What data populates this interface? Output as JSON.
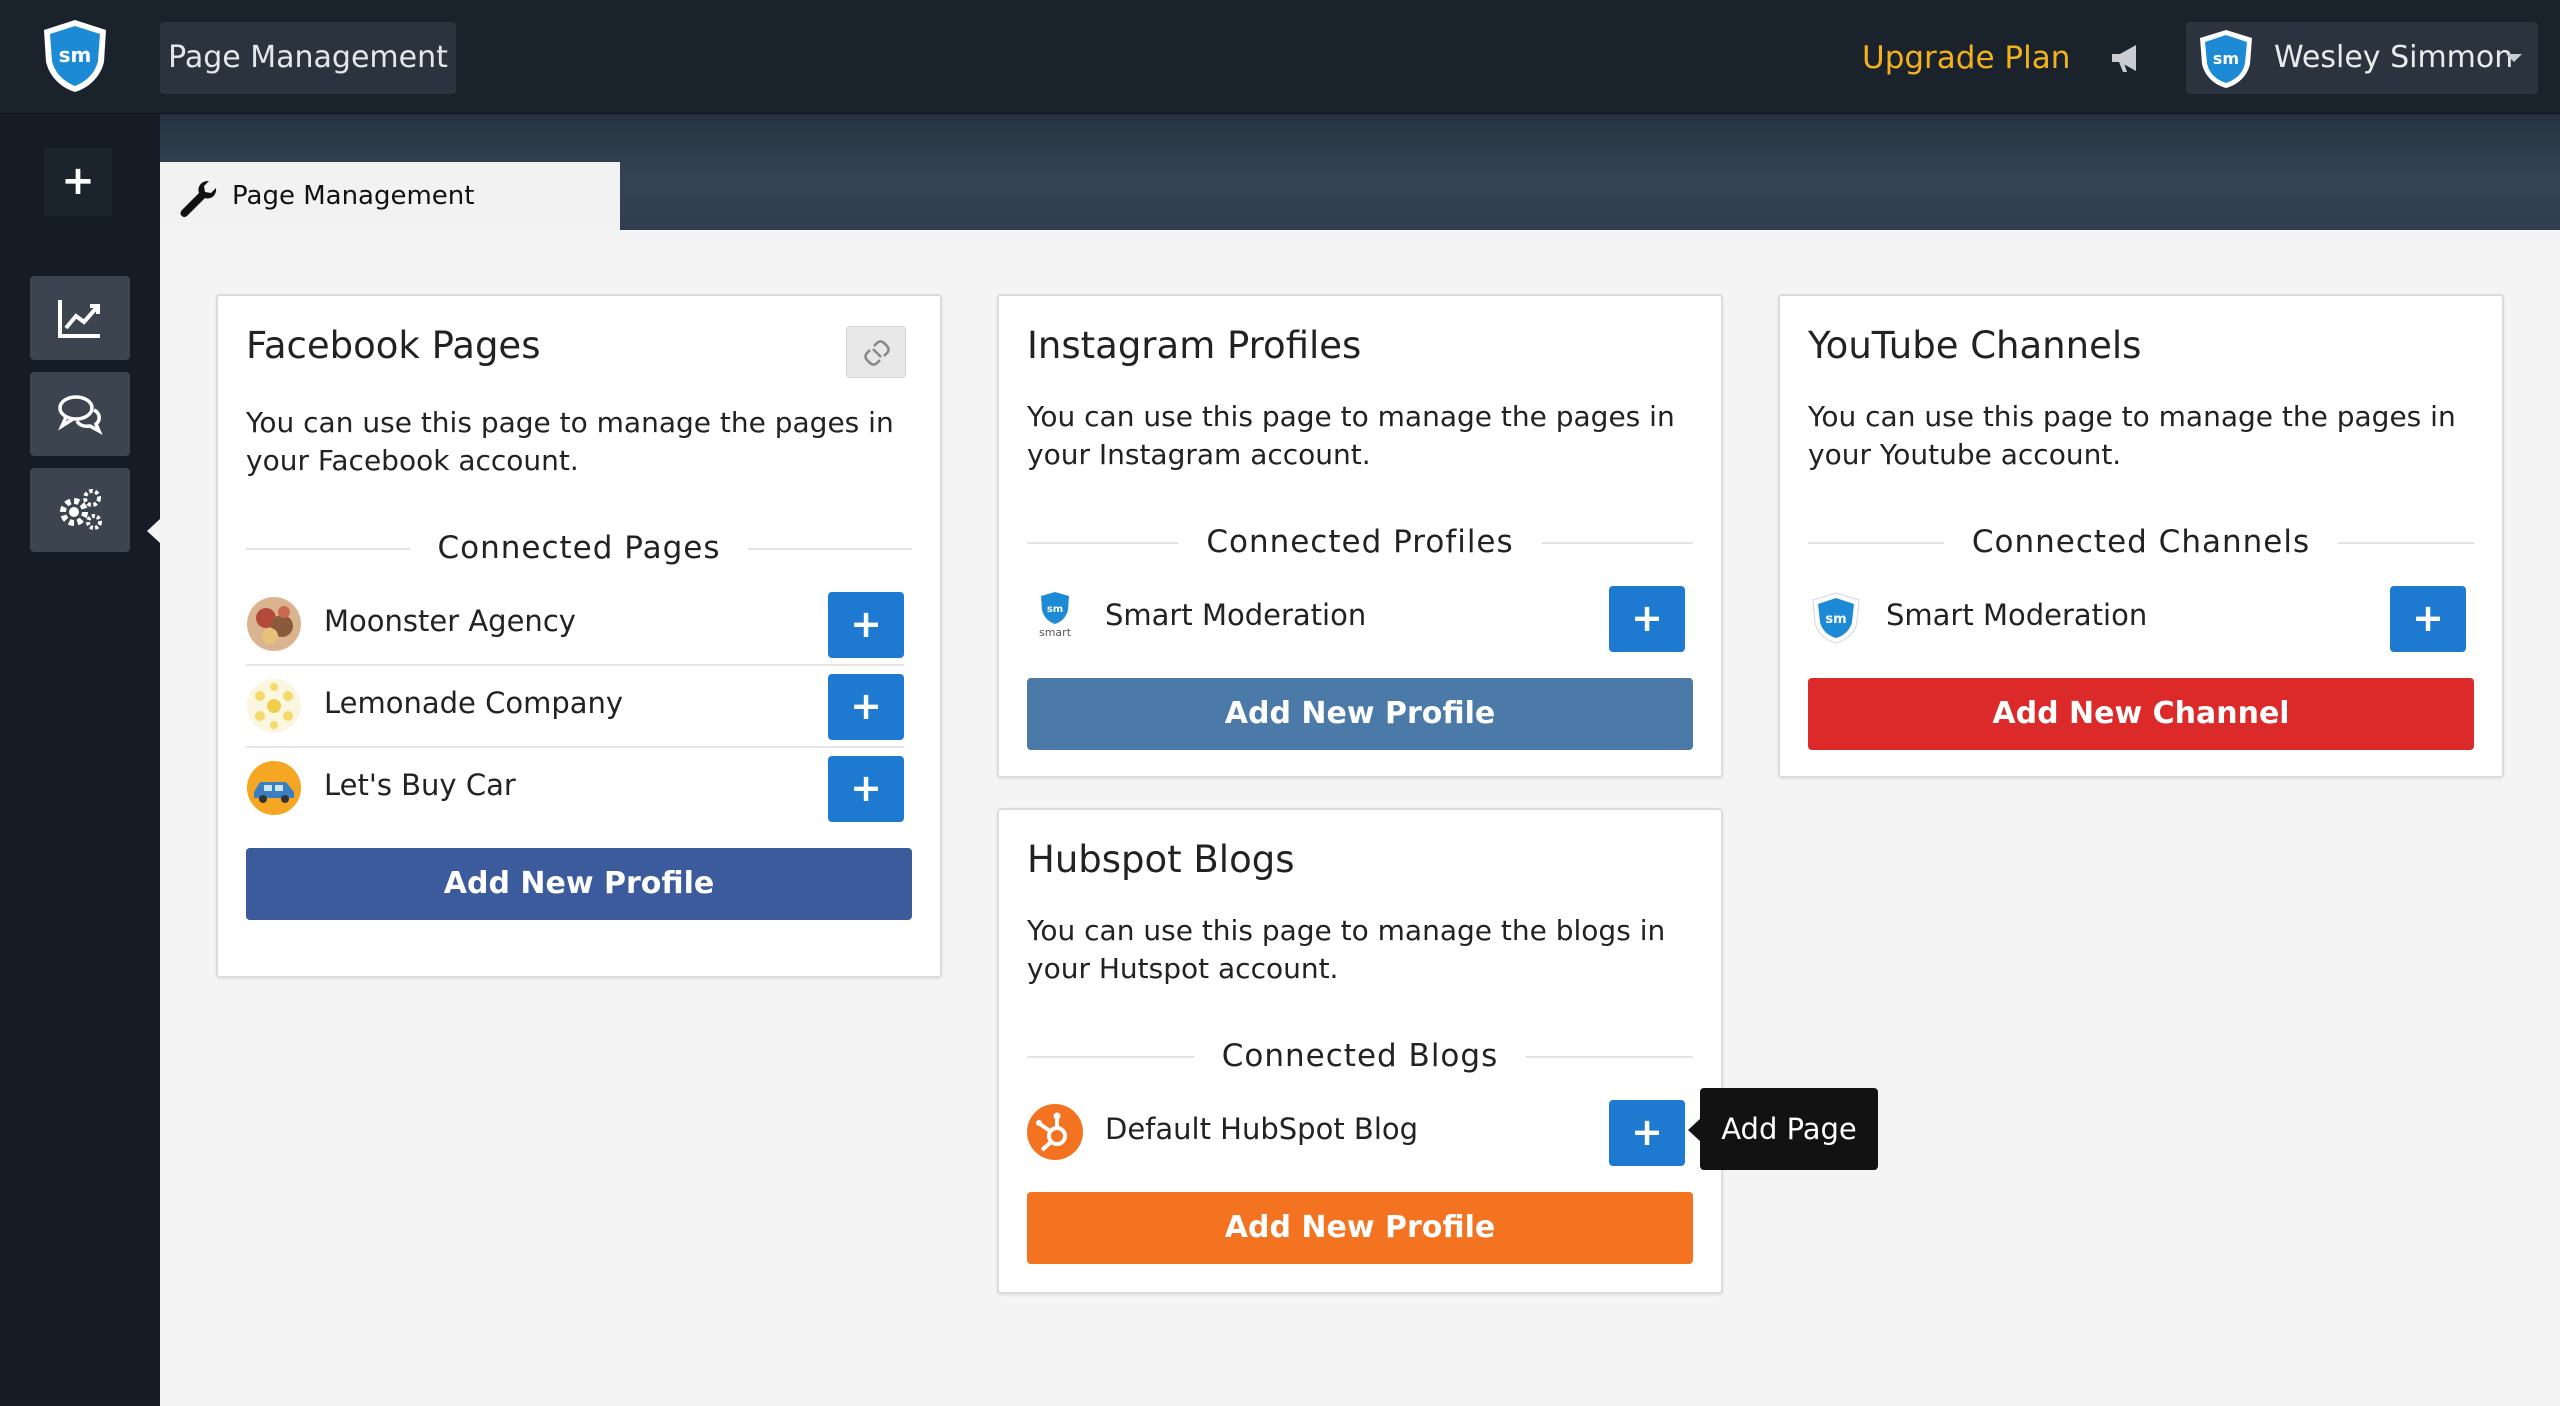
{
  "topbar": {
    "logo_text": "sm",
    "nav_label": "Page Management",
    "upgrade_label": "Upgrade Plan",
    "user_name": "Wesley Simmon",
    "icons": [
      "megaphone-icon",
      "chevron-down-icon"
    ]
  },
  "sidebar": {
    "add_label": "+",
    "items": [
      {
        "icon": "chart-icon"
      },
      {
        "icon": "chat-icon"
      },
      {
        "icon": "gears-icon"
      }
    ]
  },
  "tab": {
    "label": "Page Management",
    "icon": "wrench-icon"
  },
  "cards": {
    "facebook": {
      "title": "Facebook Pages",
      "description": "You can use this page to manage the pages in your Facebook account.",
      "section": "Connected Pages",
      "items": [
        {
          "label": "Moonster Agency",
          "button": "+"
        },
        {
          "label": "Lemonade Company",
          "button": "+"
        },
        {
          "label": "Let's Buy Car",
          "button": "+"
        }
      ],
      "action": "Add New Profile",
      "color": "#3b5b9c"
    },
    "instagram": {
      "title": "Instagram Profiles",
      "description": "You can use this page to manage the pages in your Instagram account.",
      "section": "Connected Profiles",
      "items": [
        {
          "label": "Smart Moderation",
          "button": "+",
          "icon_caption": "smart"
        }
      ],
      "action": "Add New Profile",
      "color": "#4c7aa8"
    },
    "youtube": {
      "title": "YouTube Channels",
      "description": "You can use this page to manage the pages in your Youtube account.",
      "section": "Connected Channels",
      "items": [
        {
          "label": "Smart Moderation",
          "button": "+"
        }
      ],
      "action": "Add New Channel",
      "color": "#dc2a2a"
    },
    "hubspot": {
      "title": "Hubspot Blogs",
      "description": "You can use this page to manage the blogs in your Hutspot account.",
      "section": "Connected Blogs",
      "items": [
        {
          "label": "Default HubSpot Blog",
          "button": "+"
        }
      ],
      "action": "Add New Profile",
      "color": "#f37321"
    }
  },
  "tooltip": {
    "label": "Add Page"
  },
  "colors": {
    "accent_blue": "#1d7ad0",
    "upgrade": "#f3b21d"
  }
}
